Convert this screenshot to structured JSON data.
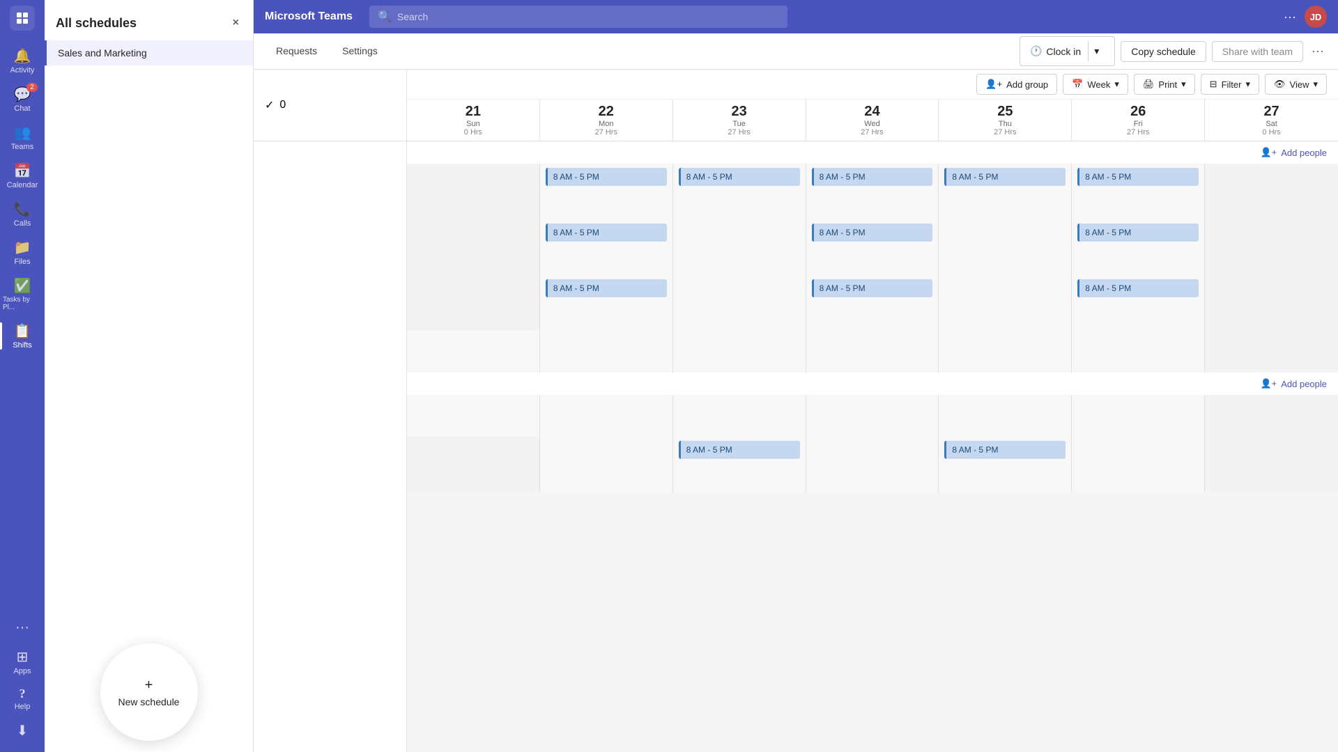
{
  "app": {
    "title": "Microsoft Teams"
  },
  "nav": {
    "items": [
      {
        "id": "activity",
        "label": "Activity",
        "icon": "🔔",
        "badge": null,
        "active": false
      },
      {
        "id": "chat",
        "label": "Chat",
        "icon": "💬",
        "badge": "2",
        "active": false
      },
      {
        "id": "teams",
        "label": "Teams",
        "icon": "👥",
        "badge": null,
        "active": false
      },
      {
        "id": "calendar",
        "label": "Calendar",
        "icon": "📅",
        "badge": null,
        "active": false
      },
      {
        "id": "calls",
        "label": "Calls",
        "icon": "📞",
        "badge": null,
        "active": false
      },
      {
        "id": "files",
        "label": "Files",
        "icon": "📁",
        "badge": null,
        "active": false
      },
      {
        "id": "tasks",
        "label": "Tasks by Pl...",
        "icon": "✅",
        "badge": null,
        "active": false
      },
      {
        "id": "shifts",
        "label": "Shifts",
        "icon": "📋",
        "badge": null,
        "active": true
      }
    ],
    "bottom_items": [
      {
        "id": "apps",
        "label": "Apps",
        "icon": "⊞"
      },
      {
        "id": "help",
        "label": "Help",
        "icon": "?"
      },
      {
        "id": "download",
        "label": "Download",
        "icon": "⬇"
      }
    ],
    "more": "···"
  },
  "sidebar": {
    "title": "All schedules",
    "close_label": "×",
    "items": [
      {
        "label": "Sales and Marketing",
        "active": true
      }
    ],
    "new_schedule_label": "New schedule",
    "new_schedule_plus": "+"
  },
  "search": {
    "placeholder": "Search"
  },
  "toolbar": {
    "tabs": [
      {
        "label": "Requests"
      },
      {
        "label": "Settings"
      }
    ],
    "clock_in_label": "Clock in",
    "clock_in_icon": "🕐",
    "copy_schedule_label": "Copy schedule",
    "share_team_label": "Share with team",
    "more_label": "···"
  },
  "calendar_header": {
    "check_count": "0",
    "add_group_label": "Add group",
    "week_label": "Week",
    "print_label": "Print",
    "filter_label": "Filter",
    "view_label": "View",
    "add_people_label": "Add people"
  },
  "days": [
    {
      "number": "21",
      "name": "Sun",
      "hrs": "0 Hrs"
    },
    {
      "number": "22",
      "name": "Mon",
      "hrs": "27 Hrs"
    },
    {
      "number": "23",
      "name": "Tue",
      "hrs": "27 Hrs"
    },
    {
      "number": "24",
      "name": "Wed",
      "hrs": "27 Hrs"
    },
    {
      "number": "25",
      "name": "Thu",
      "hrs": "27 Hrs"
    },
    {
      "number": "26",
      "name": "Fri",
      "hrs": "27 Hrs"
    },
    {
      "number": "27",
      "name": "Sat",
      "hrs": "0 Hrs"
    }
  ],
  "shifts": {
    "label": "8 AM - 5 PM",
    "rows": [
      {
        "cells": [
          false,
          true,
          true,
          true,
          true,
          true,
          false
        ]
      },
      {
        "cells": [
          false,
          true,
          false,
          true,
          false,
          true,
          false
        ]
      },
      {
        "cells": [
          false,
          true,
          false,
          true,
          false,
          true,
          false
        ]
      }
    ],
    "extra_row": {
      "cells": [
        false,
        false,
        true,
        false,
        true,
        false,
        false
      ]
    }
  },
  "avatar": {
    "initials": "JD"
  },
  "colors": {
    "nav_bg": "#4b53bc",
    "shift_bg": "#c5d8f0",
    "shift_border": "#3a7abf",
    "shift_text": "#1a4a7a",
    "active_nav": "white"
  }
}
